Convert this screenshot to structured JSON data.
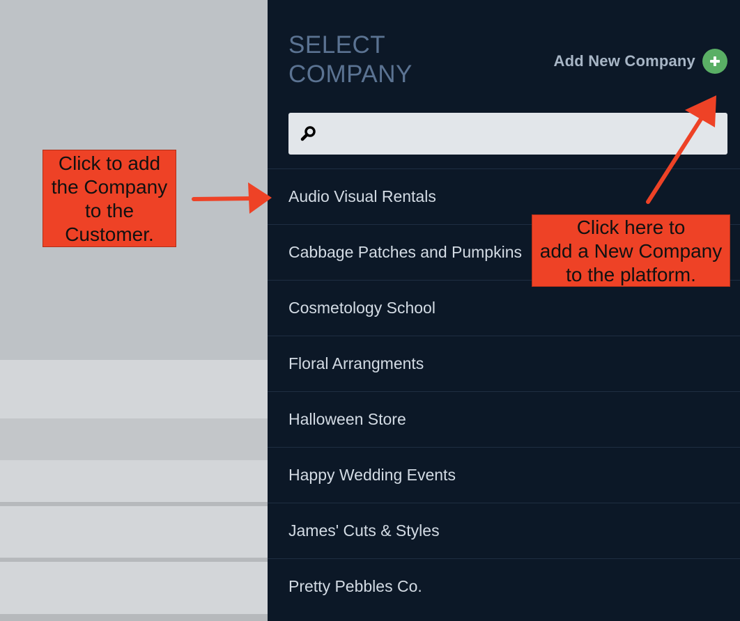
{
  "panel": {
    "title_line1": "SELECT",
    "title_line2": "COMPANY",
    "add_company_label": "Add New Company",
    "search": {
      "value": "",
      "placeholder": ""
    },
    "companies": [
      "Audio Visual Rentals",
      "Cabbage Patches and Pumpkins",
      "Cosmetology School",
      "Floral Arrangments",
      "Halloween Store",
      "Happy Wedding Events",
      "James' Cuts & Styles",
      "Pretty Pebbles Co."
    ]
  },
  "annotations": {
    "left_callout": [
      "Click to add",
      "the Company",
      "to the",
      "Customer."
    ],
    "right_callout": [
      "Click here to",
      "add a New Company",
      "to the platform."
    ]
  },
  "icons": {
    "add": "plus-circle-icon",
    "search": "search-icon",
    "arrow": "arrow-icon"
  },
  "colors": {
    "panel_bg": "#0c1827",
    "title": "#5b7392",
    "add_button": "#5aaf65",
    "callout": "#ee4226",
    "arrow": "#ee4226"
  }
}
